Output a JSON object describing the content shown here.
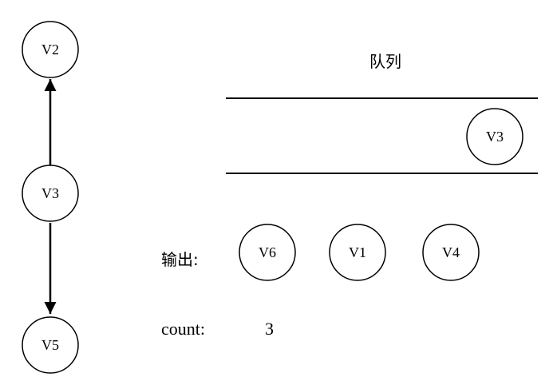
{
  "graph": {
    "nodes": [
      {
        "id": "V2",
        "label": "V2"
      },
      {
        "id": "V3",
        "label": "V3"
      },
      {
        "id": "V5",
        "label": "V5"
      }
    ],
    "edges": [
      {
        "from": "V3",
        "to": "V2"
      },
      {
        "from": "V3",
        "to": "V5"
      }
    ]
  },
  "queue": {
    "title": "队列",
    "items": [
      "V3"
    ]
  },
  "output": {
    "label": "输出:",
    "items": [
      "V6",
      "V1",
      "V4"
    ]
  },
  "count": {
    "label": "count:",
    "value": "3"
  }
}
